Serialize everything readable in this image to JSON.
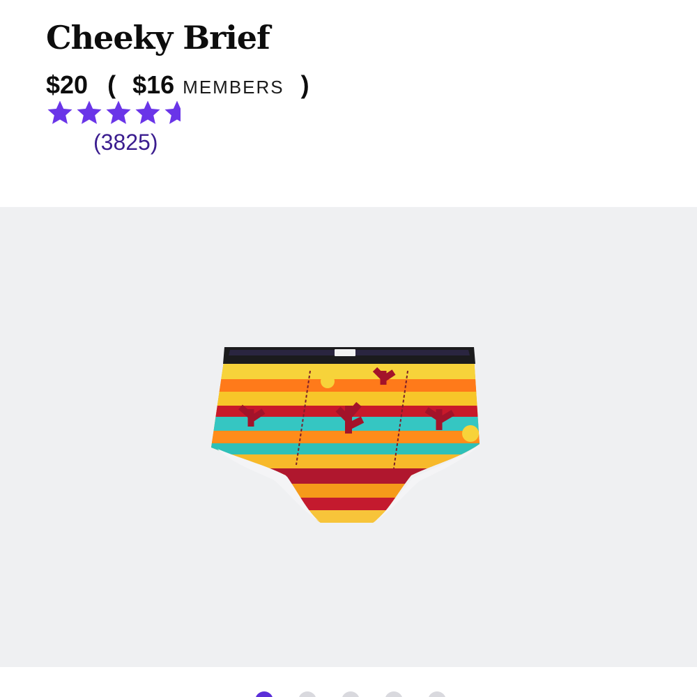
{
  "product": {
    "title": "Cheeky Brief",
    "price": "$20",
    "paren_open": "(",
    "member_price": "$16",
    "member_label": "MEMBERS",
    "paren_close": ")"
  },
  "rating": {
    "value": 4.5,
    "max": 5,
    "review_count": "(3825)",
    "star_color": "#6a35e8"
  },
  "gallery": {
    "background": "#eff0f2",
    "image": "desert-cactus-print-cheeky-brief",
    "slide_count": 5,
    "active_slide": 1
  },
  "colors": {
    "accent": "#5b2fd8",
    "review_text": "#3b1d8f"
  }
}
